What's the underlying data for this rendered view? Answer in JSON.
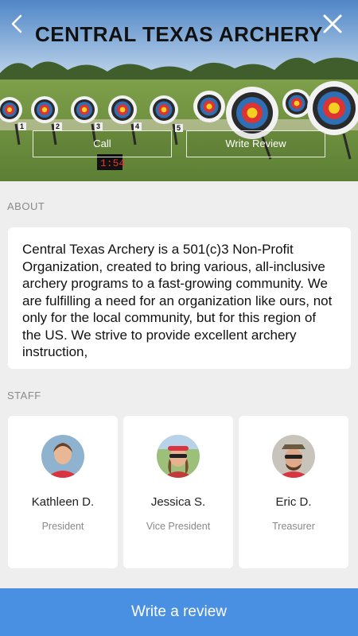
{
  "header": {
    "title": "CENTRAL TEXAS ARCHERY",
    "back_icon": "chevron-left-icon",
    "close_icon": "close-icon",
    "call_label": "Call",
    "write_review_label": "Write Review",
    "scoreboard_text": "1:54",
    "target_numbers": [
      "1",
      "2",
      "3",
      "4",
      "5"
    ]
  },
  "about": {
    "label": "ABOUT",
    "text": "Central Texas Archery is a 501(c)3 Non-Profit Organization, created to bring various, all-inclusive archery programs to a fast-growing community.  We are fulfilling a need for an organization like ours, not only for the local community, but for this region of the US.  We strive to provide excellent archery instruction,"
  },
  "staff": {
    "label": "STAFF",
    "members": [
      {
        "name": "Kathleen D.",
        "role": "President"
      },
      {
        "name": "Jessica S.",
        "role": "Vice President"
      },
      {
        "name": "Eric D.",
        "role": "Treasurer"
      }
    ]
  },
  "footer": {
    "cta_label": "Write a review"
  },
  "colors": {
    "accent": "#4a90e2",
    "card": "#ffffff",
    "background": "#eeeeee"
  }
}
